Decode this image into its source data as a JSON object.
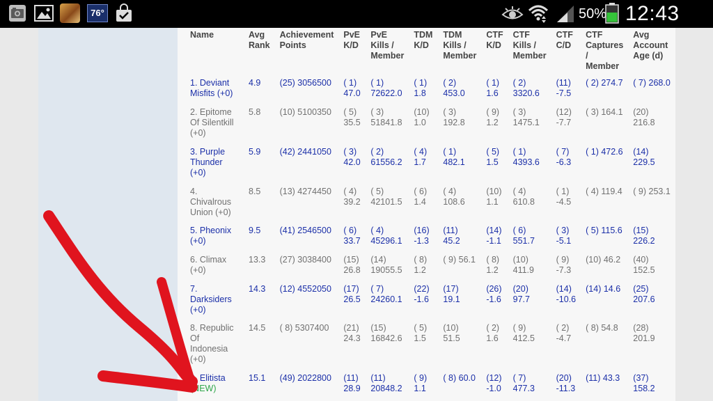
{
  "status_bar": {
    "temperature": "76°",
    "battery_percent": "50%",
    "time": "12:43 AM",
    "icons": [
      "photo-notification-icon",
      "gallery-icon",
      "game-app-icon",
      "weather-icon",
      "shopping-bag-icon",
      "eye-icon",
      "wifi-icon",
      "signal-icon",
      "battery-icon"
    ]
  },
  "table": {
    "headers": [
      "Name",
      "Avg Rank",
      "Achievement Points",
      "PvE K/D",
      "PvE Kills / Member",
      "TDM K/D",
      "TDM Kills / Member",
      "CTF K/D",
      "CTF Kills / Member",
      "CTF C/D",
      "CTF Captures / Member",
      "Avg Account Age (d)"
    ],
    "rows": [
      [
        "1. Deviant Misfits (+0)",
        "4.9",
        "(25) 3056500",
        "( 1) 47.0",
        "( 1) 72622.0",
        "( 1) 1.8",
        "( 2) 453.0",
        "( 1) 1.6",
        "( 2) 3320.6",
        "(11) -7.5",
        "( 2) 274.7",
        "( 7) 268.0"
      ],
      [
        "2. Epitome Of Silentkill (+0)",
        "5.8",
        "(10) 5100350",
        "( 5) 35.5",
        "( 3) 51841.8",
        "(10) 1.0",
        "( 3) 192.8",
        "( 9) 1.2",
        "( 3) 1475.1",
        "(12) -7.7",
        "( 3) 164.1",
        "(20) 216.8"
      ],
      [
        "3. Purple Thunder (+0)",
        "5.9",
        "(42) 2441050",
        "( 3) 42.0",
        "( 2) 61556.2",
        "( 4) 1.7",
        "( 1) 482.1",
        "( 5) 1.5",
        "( 1) 4393.6",
        "( 7) -6.3",
        "( 1) 472.6",
        "(14) 229.5"
      ],
      [
        "4. Chivalrous Union (+0)",
        "8.5",
        "(13) 4274450",
        "( 4) 39.2",
        "( 5) 42101.5",
        "( 6) 1.4",
        "( 4) 108.6",
        "(10) 1.1",
        "( 4) 610.8",
        "( 1) -4.5",
        "( 4) 119.4",
        "( 9) 253.1"
      ],
      [
        "5. Pheonix (+0)",
        "9.5",
        "(41) 2546500",
        "( 6) 33.7",
        "( 4) 45296.1",
        "(16) -1.3",
        "(11) 45.2",
        "(14) -1.1",
        "( 6) 551.7",
        "( 3) -5.1",
        "( 5) 115.6",
        "(15) 226.2"
      ],
      [
        "6. Climax (+0)",
        "13.3",
        "(27) 3038400",
        "(15) 26.8",
        "(14) 19055.5",
        "( 8) 1.2",
        "( 9) 56.1",
        "( 8) 1.2",
        "(10) 411.9",
        "( 9) -7.3",
        "(10) 46.2",
        "(40) 152.5"
      ],
      [
        "7. Darksiders (+0)",
        "14.3",
        "(12) 4552050",
        "(17) 26.5",
        "( 7) 24260.1",
        "(22) -1.6",
        "(17) 19.1",
        "(26) -1.6",
        "(20) 97.7",
        "(14) -10.6",
        "(14) 14.6",
        "(25) 207.6"
      ],
      [
        "8. Republic Of Indonesia (+0)",
        "14.5",
        "( 8) 5307400",
        "(21) 24.3",
        "(15) 16842.6",
        "( 5) 1.5",
        "(10) 51.5",
        "( 2) 1.6",
        "( 9) 412.5",
        "( 2) -4.7",
        "( 8) 54.8",
        "(28) 201.9"
      ],
      [
        "9. Elitista",
        "15.1",
        "(49) 2022800",
        "(11) 28.9",
        "(11) 20848.2",
        "( 9) 1.1",
        "( 8) 60.0",
        "(12) -1.0",
        "( 7) 477.3",
        "(20) -11.3",
        "(11) 43.3",
        "(37) 158.2"
      ]
    ],
    "new_label": "(NEW)"
  },
  "colors": {
    "link_blue": "#1b2fa8",
    "gray_text": "#707070",
    "new_green": "#2fa64a",
    "annotation_red": "#e0141e"
  }
}
